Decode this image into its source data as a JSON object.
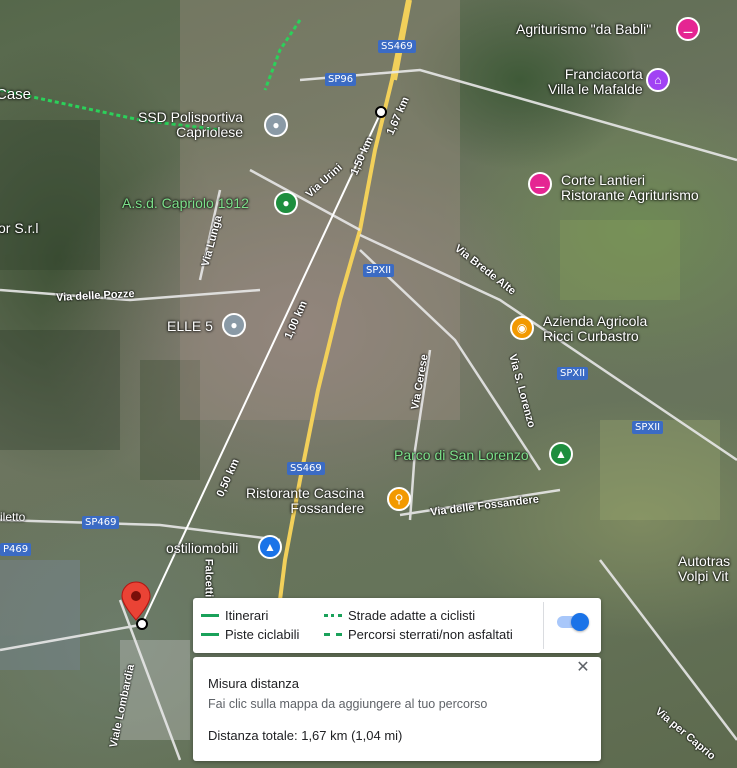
{
  "map": {
    "places": {
      "agriturismo_babli": "Agriturismo \"da Babli\"",
      "franciacorta_line1": "Franciacorta",
      "franciacorta_line2": "Villa le Mafalde",
      "ssd_line1": "SSD Polisportiva",
      "ssd_line2": "Capriolese",
      "asd_capriolo": "A.s.d. Capriolo 1912",
      "corte_line1": "Corte Lantieri",
      "corte_line2": "Ristorante Agriturismo",
      "elle5": "ELLE 5",
      "azienda_line1": "Azienda Agricola",
      "azienda_line2": "Ricci Curbastro",
      "parco": "Parco di San Lorenzo",
      "ristorante_line1": "Ristorante Cascina",
      "ristorante_line2": "Fossandere",
      "ostiliomobili": "ostiliomobili",
      "autotras_line1": "Autotras",
      "autotras_line2": "Volpi Vit",
      "case": "Case",
      "or_srl": "or S.r.l",
      "iletto": "iletto"
    },
    "roads": {
      "via_urini": "Via Urini",
      "via_lunga": "Via Lunga",
      "via_delle_pozze": "Via delle Pozze",
      "via_brede_alte": "Via Brede Alte",
      "via_cerese": "Via Cerese",
      "via_s_lorenzo": "Via S. Lorenzo",
      "via_delle_fossandere": "Via delle Fossandere",
      "falcetti": "Falcetti",
      "viale_lombardia": "Viale Lombardia",
      "via_per_capriolo": "Via per Caprio"
    },
    "shields": {
      "ss469_top": "SS469",
      "sp96": "SP96",
      "spxii_a": "SPXII",
      "spxii_b": "SPXII",
      "spxii_c": "SPXII",
      "ss469_mid": "SS469",
      "sp469_a": "SP469",
      "sp469_b": "P469"
    },
    "measurements": {
      "d1": "1,67 km",
      "d2": "1,50 km",
      "d3": "1,00 km",
      "d4": "0,50 km"
    },
    "colors": {
      "poi_green": "#1e8e3e",
      "poi_pink": "#e52592",
      "poi_purple": "#a142f4",
      "poi_orange": "#f29900",
      "poi_gray": "#8a9aa6",
      "poi_blue": "#1a73e8",
      "marker_red": "#ea4335"
    }
  },
  "legend": {
    "itinerari": "Itinerari",
    "piste": "Piste ciclabili",
    "strade": "Strade adatte a ciclisti",
    "percorsi": "Percorsi sterrati/non asfaltati",
    "toggle_on": true
  },
  "measure": {
    "title": "Misura distanza",
    "hint": "Fai clic sulla mappa da aggiungere al tuo percorso",
    "total": "Distanza totale: 1,67 km (1,04 mi)",
    "close_icon": "close-icon"
  }
}
